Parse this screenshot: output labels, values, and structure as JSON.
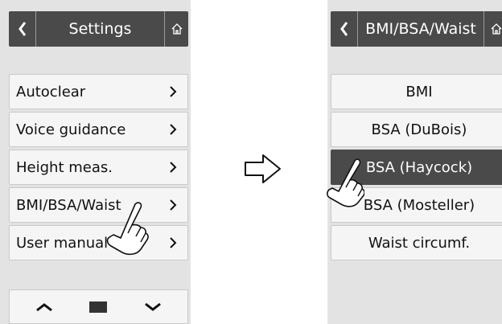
{
  "left_screen": {
    "header": {
      "title": "Settings",
      "back_icon": "chevron-left-icon",
      "home_icon": "home-icon"
    },
    "menu_items": [
      {
        "label": "Autoclear"
      },
      {
        "label": "Voice guidance"
      },
      {
        "label": "Height meas."
      },
      {
        "label": "BMI/BSA/Waist"
      },
      {
        "label": "User manual"
      }
    ],
    "pager": {
      "up_icon": "chevron-up-icon",
      "down_icon": "chevron-down-icon"
    }
  },
  "transition_icon": "right-arrow-outline-icon",
  "right_screen": {
    "header": {
      "title": "BMI/BSA/Waist",
      "back_icon": "chevron-left-icon",
      "home_icon": "home-icon"
    },
    "items": [
      {
        "label": "BMI",
        "selected": false
      },
      {
        "label": "BSA (DuBois)",
        "selected": false
      },
      {
        "label": "BSA (Haycock)",
        "selected": true
      },
      {
        "label": "BSA (Mosteller)",
        "selected": false
      },
      {
        "label": "Waist circumf.",
        "selected": false
      }
    ]
  },
  "colors": {
    "header_bg": "#4a4a4a",
    "item_bg": "#f5f5f5",
    "screen_bg": "#e3e3e3",
    "selected_bg": "#4a4a4a"
  }
}
